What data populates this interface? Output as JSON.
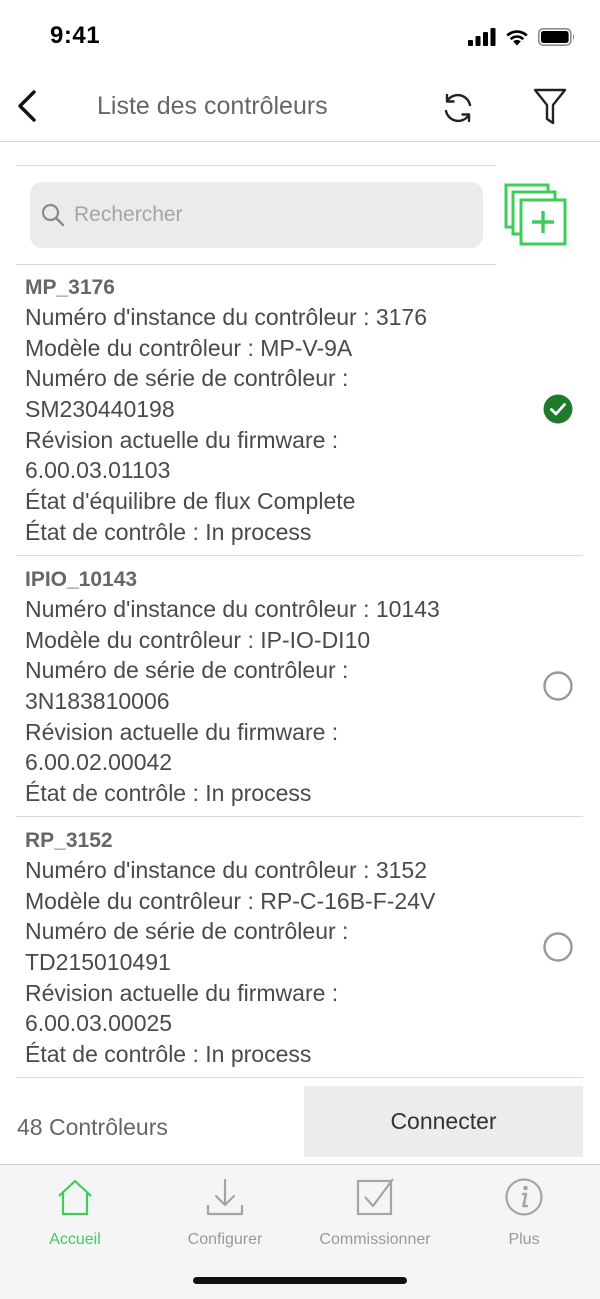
{
  "status_bar": {
    "time": "9:41"
  },
  "nav": {
    "title": "Liste des contrôleurs"
  },
  "search": {
    "placeholder": "Rechercher",
    "value": ""
  },
  "colors": {
    "accent": "#3dcd58",
    "checked": "#1f7a2c",
    "muted": "#9a9a9a"
  },
  "controllers": [
    {
      "name": "MP_3176",
      "lines": [
        "Numéro d'instance du contrôleur : 3176",
        "Modèle du contrôleur : MP-V-9A",
        "Numéro de série de contrôleur :",
        "SM230440198",
        "Révision actuelle du firmware :",
        "6.00.03.01103",
        "État d'équilibre de flux Complete",
        "État de contrôle : In process"
      ],
      "selected": true
    },
    {
      "name": "IPIO_10143",
      "lines": [
        "Numéro d'instance du contrôleur : 10143",
        "Modèle du contrôleur : IP-IO-DI10",
        "Numéro de série de contrôleur :",
        "3N183810006",
        "Révision actuelle du firmware :",
        "6.00.02.00042",
        "État de contrôle : In process"
      ],
      "selected": false
    },
    {
      "name": "RP_3152",
      "lines": [
        "Numéro d'instance du contrôleur : 3152",
        "Modèle du contrôleur : RP-C-16B-F-24V",
        "Numéro de série de contrôleur :",
        "TD215010491",
        "Révision actuelle du firmware :",
        "6.00.03.00025",
        "État de contrôle : In process"
      ],
      "selected": false
    }
  ],
  "footer": {
    "count_label": "48 Contrôleurs",
    "connect_label": "Connecter"
  },
  "tabs": [
    {
      "label": "Accueil",
      "icon": "home-icon",
      "active": true
    },
    {
      "label": "Configurer",
      "icon": "download-icon",
      "active": false
    },
    {
      "label": "Commissionner",
      "icon": "checkbox-icon",
      "active": false
    },
    {
      "label": "Plus",
      "icon": "info-icon",
      "active": false
    }
  ]
}
